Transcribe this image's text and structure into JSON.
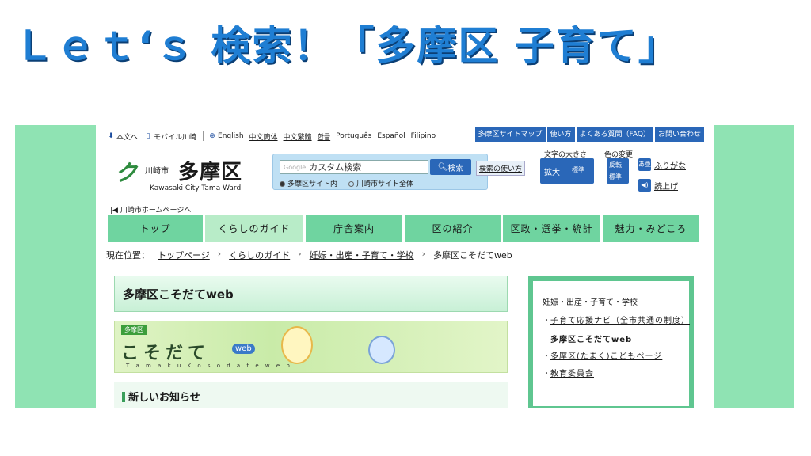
{
  "slide_title": "Ｌｅｔ‘ｓ 検索！「多摩区 子育て」",
  "util": {
    "text_only": "本文へ",
    "mobile": "モバイル川崎",
    "languages": [
      "English",
      "中文簡体",
      "中文繁體",
      "한글",
      "Português",
      "Español",
      "Filipino"
    ]
  },
  "topnav": [
    "多摩区サイトマップ",
    "使い方",
    "よくある質問（FAQ）",
    "お問い合わせ"
  ],
  "logo": {
    "mark": "ク",
    "city": "川崎市",
    "ward": "多摩区",
    "en": "Kawasaki City Tama Ward"
  },
  "search": {
    "google": "Google",
    "placeholder": "カスタム検索",
    "button": "検索",
    "opt1": "多摩区サイト内",
    "opt2": "川崎市サイト全体",
    "howto": "検索の使い方"
  },
  "tools": {
    "size_label": "文字の大きさ",
    "color_label": "色の変更",
    "enlarge": "拡大",
    "standard": "標準",
    "invert": "反転",
    "color_standard": "標準",
    "furigana": "ふりがな",
    "furigana_icon": "あ亜",
    "read": "読上げ"
  },
  "homelink": "川崎市ホームページへ",
  "gnav": [
    "トップ",
    "くらしのガイド",
    "庁舎案内",
    "区の紹介",
    "区政・選挙・統計",
    "魅力・みどころ"
  ],
  "crumbs": {
    "label": "現在位置：",
    "items": [
      "トップページ",
      "くらしのガイド",
      "妊娠・出産・子育て・学校",
      "多摩区こそだてweb"
    ]
  },
  "main": {
    "heading": "多摩区こそだてweb",
    "banner_tag": "多摩区",
    "banner_logo": "こそだて",
    "banner_web": "web",
    "banner_romaji": "T a m a k u   K o s o d a t e   w e b",
    "news": "新しいお知らせ"
  },
  "side": {
    "head": "妊娠・出産・子育て・学校",
    "item1": "子育て応援ナビ（全市共通の制度）",
    "current": "多摩区こそだてweb",
    "item2": "多摩区(たまく)こどもページ",
    "item3": "教育委員会"
  },
  "colors": {
    "accent": "#2a67b8",
    "nav_green": "#6fd4a0",
    "frame_green": "#8fe3b3",
    "title_blue": "#1f7ed3"
  }
}
